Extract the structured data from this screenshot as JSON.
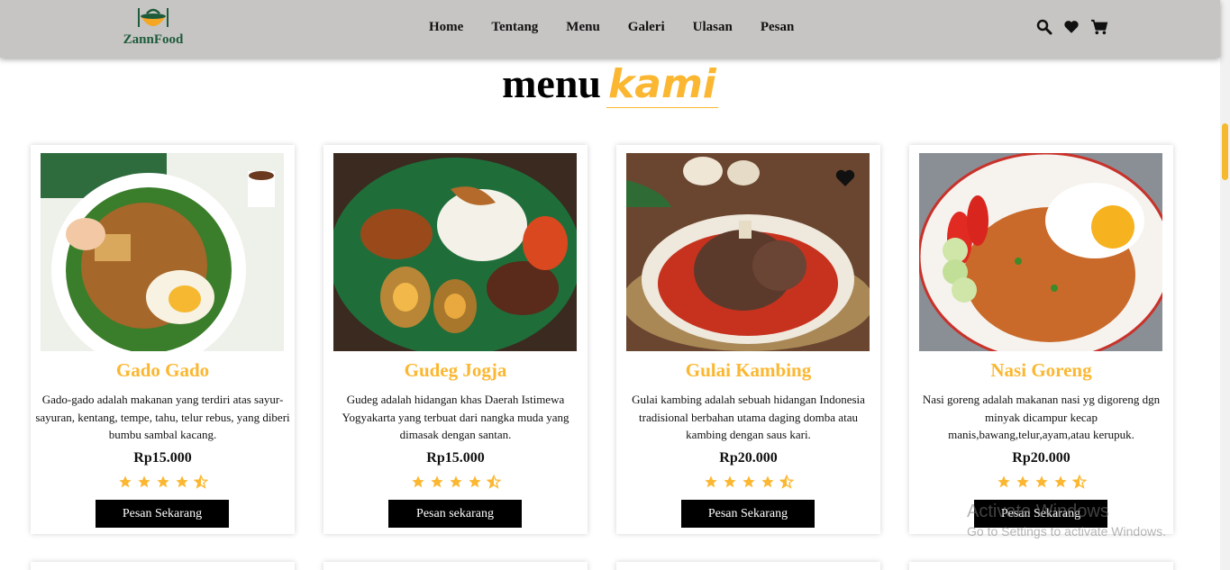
{
  "brand": {
    "name": "ZannFood"
  },
  "nav": {
    "links": [
      "Home",
      "Tentang",
      "Menu",
      "Galeri",
      "Ulasan",
      "Pesan"
    ],
    "icons": [
      "search-icon",
      "heart-icon",
      "cart-icon"
    ]
  },
  "heading": {
    "main": "menu",
    "accent": "kami"
  },
  "menu_items": [
    {
      "title": "Gado Gado",
      "description": "Gado-gado adalah makanan yang terdiri atas sayur-sayuran, kentang, tempe, tahu, telur rebus, yang diberi bumbu sambal kacang.",
      "price": "Rp15.000",
      "rating": 4.5,
      "button": "Pesan Sekarang"
    },
    {
      "title": "Gudeg Jogja",
      "description": "Gudeg adalah hidangan khas Daerah Istimewa Yogyakarta yang terbuat dari nangka muda yang dimasak dengan santan.",
      "price": "Rp15.000",
      "rating": 4.5,
      "button": "Pesan sekarang"
    },
    {
      "title": "Gulai Kambing",
      "description": "Gulai kambing adalah sebuah hidangan Indonesia tradisional berbahan utama daging domba atau kambing dengan saus kari.",
      "price": "Rp20.000",
      "rating": 4.5,
      "button": "Pesan Sekarang"
    },
    {
      "title": "Nasi Goreng",
      "description": "Nasi goreng adalah makanan nasi yg digoreng dgn minyak dicampur kecap manis,bawang,telur,ayam,atau kerupuk.",
      "price": "Rp20.000",
      "rating": 4.5,
      "button": "Pesan Sekarang"
    }
  ],
  "watermark": {
    "line1": "Activate Windows",
    "line2": "Go to Settings to activate Windows."
  },
  "colors": {
    "accent": "#fbb731",
    "navbar": "#c6c5c3",
    "button": "#000000"
  }
}
